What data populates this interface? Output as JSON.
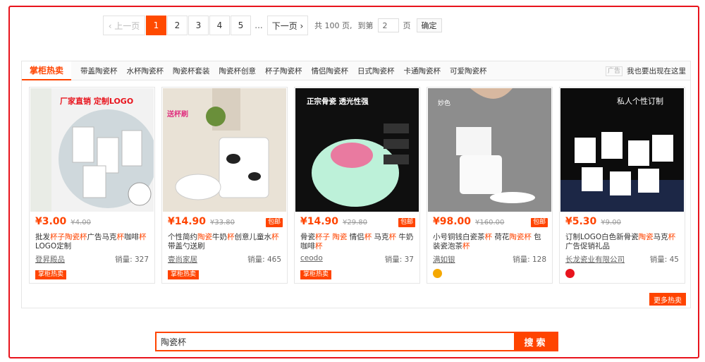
{
  "pagination": {
    "prev_label": "‹ 上一页",
    "pages": [
      "1",
      "2",
      "3",
      "4",
      "5"
    ],
    "active_page": "1",
    "ellipsis": "...",
    "next_label": "下一页 ›",
    "total_label": "共 100 页,",
    "goto_label": "到第",
    "goto_value": "2",
    "page_unit": "页",
    "confirm_label": "确定"
  },
  "hot": {
    "main_tab": "掌柜热卖",
    "tabs": [
      "带盖陶瓷杯",
      "水杯陶瓷杯",
      "陶瓷杯套装",
      "陶瓷杯创意",
      "杯子陶瓷杯",
      "情侣陶瓷杯",
      "日式陶瓷杯",
      "卡通陶瓷杯",
      "可爱陶瓷杯"
    ],
    "ad_tag": "广告",
    "ad_text": "我也要出现在这里",
    "more_label": "更多热卖",
    "items": [
      {
        "price": "¥3.00",
        "old_price": "¥4.00",
        "baoyou": "",
        "title_parts": [
          [
            "批发",
            false
          ],
          [
            "杯子",
            true
          ],
          [
            "陶瓷杯",
            true
          ],
          [
            "广告马克",
            false
          ],
          [
            "杯",
            true
          ],
          [
            "咖啡",
            false
          ],
          [
            "杯",
            true
          ],
          [
            "LOGO定制",
            false
          ]
        ],
        "shop": "登昇殿品",
        "sales": "销量: 327",
        "badge": "掌柜热卖",
        "image_text": "厂家直销 定制LOGO",
        "shop_icon": ""
      },
      {
        "price": "¥14.90",
        "old_price": "¥33.80",
        "baoyou": "包邮",
        "title_parts": [
          [
            "个性简约",
            false
          ],
          [
            "陶瓷",
            true
          ],
          [
            "牛奶",
            false
          ],
          [
            "杯",
            true
          ],
          [
            "创意儿童水",
            false
          ],
          [
            "杯",
            true
          ],
          [
            "带盖勺送刷",
            false
          ]
        ],
        "shop": "壹尚家居",
        "sales": "销量: 465",
        "badge": "掌柜热卖",
        "image_text": "送杯刷",
        "shop_icon": ""
      },
      {
        "price": "¥14.90",
        "old_price": "¥29.80",
        "baoyou": "包邮",
        "title_parts": [
          [
            "骨瓷",
            false
          ],
          [
            "杯子",
            true
          ],
          [
            " ",
            false
          ],
          [
            "陶瓷",
            true
          ],
          [
            " 情侣",
            false
          ],
          [
            "杯",
            true
          ],
          [
            " 马克",
            false
          ],
          [
            "杯",
            true
          ],
          [
            " 牛奶咖啡",
            false
          ],
          [
            "杯",
            true
          ]
        ],
        "shop": "ceodo",
        "sales": "销量: 37",
        "badge": "掌柜热卖",
        "image_text": "正宗骨瓷 透光性强",
        "shop_icon": ""
      },
      {
        "price": "¥98.00",
        "old_price": "¥160.00",
        "baoyou": "包邮",
        "title_parts": [
          [
            "小号铜钱白瓷茶",
            false
          ],
          [
            "杯",
            true
          ],
          [
            " 荷花",
            false
          ],
          [
            "陶瓷杯",
            true
          ],
          [
            " 包装瓷泡茶",
            false
          ],
          [
            "杯",
            true
          ]
        ],
        "shop": "满如银",
        "sales": "销量: 128",
        "badge": "",
        "image_text": "妙色",
        "shop_icon": "#f5a800"
      },
      {
        "price": "¥5.30",
        "old_price": "¥9.00",
        "baoyou": "",
        "title_parts": [
          [
            "订制LOGO白色新骨瓷",
            false
          ],
          [
            "陶瓷",
            true
          ],
          [
            "马克",
            false
          ],
          [
            "杯",
            true
          ],
          [
            "广告促销礼品",
            false
          ]
        ],
        "shop": "长龙瓷业有限公司",
        "sales": "销量: 45",
        "badge": "",
        "image_text": "私人个性订制",
        "shop_icon": "#e8141d"
      }
    ]
  },
  "search": {
    "value": "陶瓷杯",
    "button_label": "搜索"
  },
  "colors": {
    "accent": "#ff4400",
    "frame": "#e8141d"
  }
}
